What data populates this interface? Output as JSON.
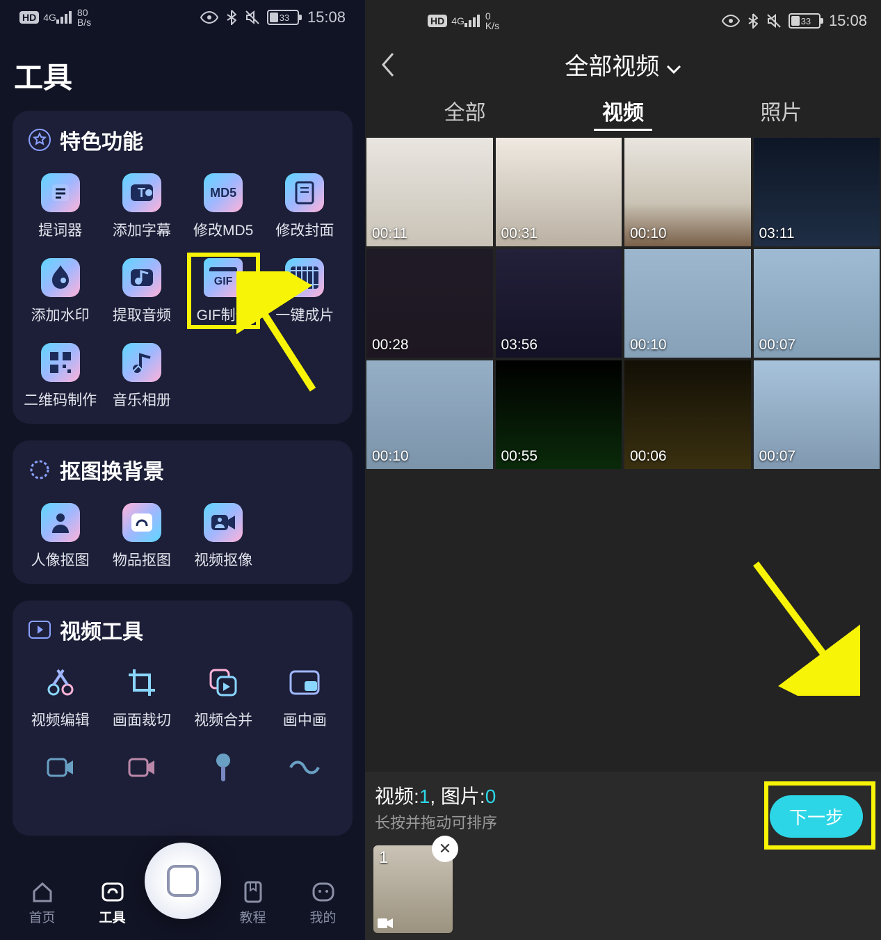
{
  "status": {
    "hd": "HD",
    "g": "4G",
    "rateL": "80",
    "rateUnitL": "B/s",
    "rateR": "0",
    "rateUnitR": "K/s",
    "batt": "33",
    "time": "15:08"
  },
  "l": {
    "title": "工具",
    "s1": {
      "title": "特色功能",
      "items": [
        "提词器",
        "添加字幕",
        "修改MD5",
        "修改封面",
        "添加水印",
        "提取音频",
        "GIF制作",
        "一键成片",
        "二维码制作",
        "音乐相册"
      ],
      "md5": "MD5",
      "gif": "GIF"
    },
    "s2": {
      "title": "抠图换背景",
      "items": [
        "人像抠图",
        "物品抠图",
        "视频抠像"
      ]
    },
    "s3": {
      "title": "视频工具",
      "items": [
        "视频编辑",
        "画面裁切",
        "视频合并",
        "画中画"
      ]
    },
    "nav": [
      "首页",
      "工具",
      "教程",
      "我的"
    ]
  },
  "r": {
    "title": "全部视频",
    "tabs": [
      "全部",
      "视频",
      "照片"
    ],
    "durs": [
      "00:11",
      "00:31",
      "00:10",
      "03:11",
      "00:28",
      "03:56",
      "00:10",
      "00:07",
      "00:10",
      "00:55",
      "00:06",
      "00:07"
    ],
    "footer": {
      "vl": "视频:",
      "vn": "1",
      "il": ", 图片:",
      "in": "0",
      "hint": "长按并拖动可排序",
      "next": "下一步",
      "selN": "1"
    }
  }
}
